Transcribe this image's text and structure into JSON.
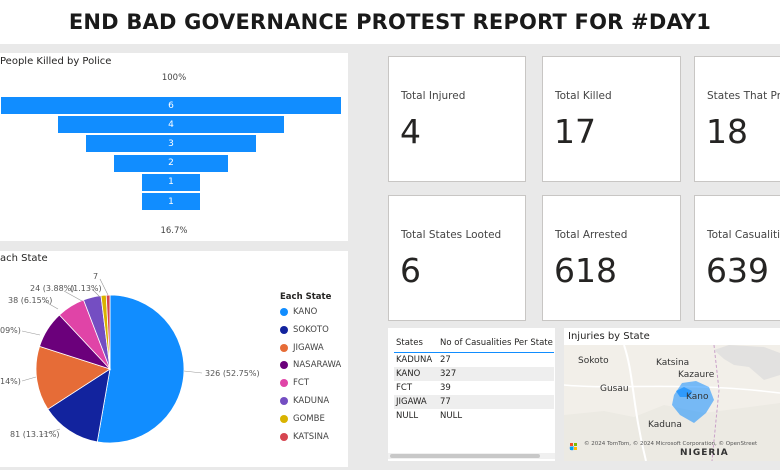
{
  "report_title": "END BAD GOVERNANCE PROTEST REPORT FOR #DAY1",
  "funnel": {
    "title": "People Killed by Police",
    "top_pct": "100%",
    "bottom_pct": "16.7%",
    "bars": [
      "6",
      "4",
      "3",
      "2",
      "1",
      "1"
    ]
  },
  "cards": [
    {
      "label": "Total Injured",
      "value": "4"
    },
    {
      "label": "Total Killed",
      "value": "17"
    },
    {
      "label": "States That Pro",
      "value": "18"
    },
    {
      "label": "Total States Looted",
      "value": "6"
    },
    {
      "label": "Total Arrested",
      "value": "618"
    },
    {
      "label": "Total Casualitie",
      "value": "639"
    }
  ],
  "pie": {
    "title": "ach State",
    "legend_title": "Each State",
    "legend": [
      {
        "name": "KANO",
        "color": "#118dff"
      },
      {
        "name": "SOKOTO",
        "color": "#12239e"
      },
      {
        "name": "JIGAWA",
        "color": "#e66c37"
      },
      {
        "name": "NASARAWA",
        "color": "#6b007b"
      },
      {
        "name": "FCT",
        "color": "#e044a7"
      },
      {
        "name": "KADUNA",
        "color": "#744ec2"
      },
      {
        "name": "GOMBE",
        "color": "#d9b300"
      },
      {
        "name": "KATSINA",
        "color": "#d64550"
      }
    ],
    "labels": {
      "kano": "326 (52.75%)",
      "sokoto": "81 (13.11%)",
      "jigawa": "14%)",
      "nasarawa": "09%)",
      "fct": "38 (6.15%)",
      "kaduna": "24 (3.88%)",
      "gombe": "(1.13%)",
      "katsina": "7"
    }
  },
  "chart_data": {
    "type": "pie",
    "categories": [
      "KANO",
      "SOKOTO",
      "JIGAWA",
      "NASARAWA",
      "FCT",
      "KADUNA",
      "GOMBE",
      "KATSINA"
    ],
    "values": [
      326,
      81,
      87,
      50,
      38,
      24,
      7,
      5
    ]
  },
  "table": {
    "headers": [
      "States",
      "No of Casualities Per State"
    ],
    "rows": [
      [
        "KADUNA",
        "27"
      ],
      [
        "KANO",
        "327"
      ],
      [
        "FCT",
        "39"
      ],
      [
        "JIGAWA",
        "77"
      ],
      [
        "NULL",
        "NULL"
      ]
    ]
  },
  "map": {
    "title": "Injuries by State",
    "places": {
      "sokoto": "Sokoto",
      "katsina": "Katsina",
      "gusau": "Gusau",
      "kazaure": "Kazaure",
      "kano": "Kano",
      "kaduna": "Kaduna",
      "nigeria": "NIGERIA"
    },
    "copyright": "© 2024 TomTom, © 2024 Microsoft Corporation, © OpenStreet"
  }
}
